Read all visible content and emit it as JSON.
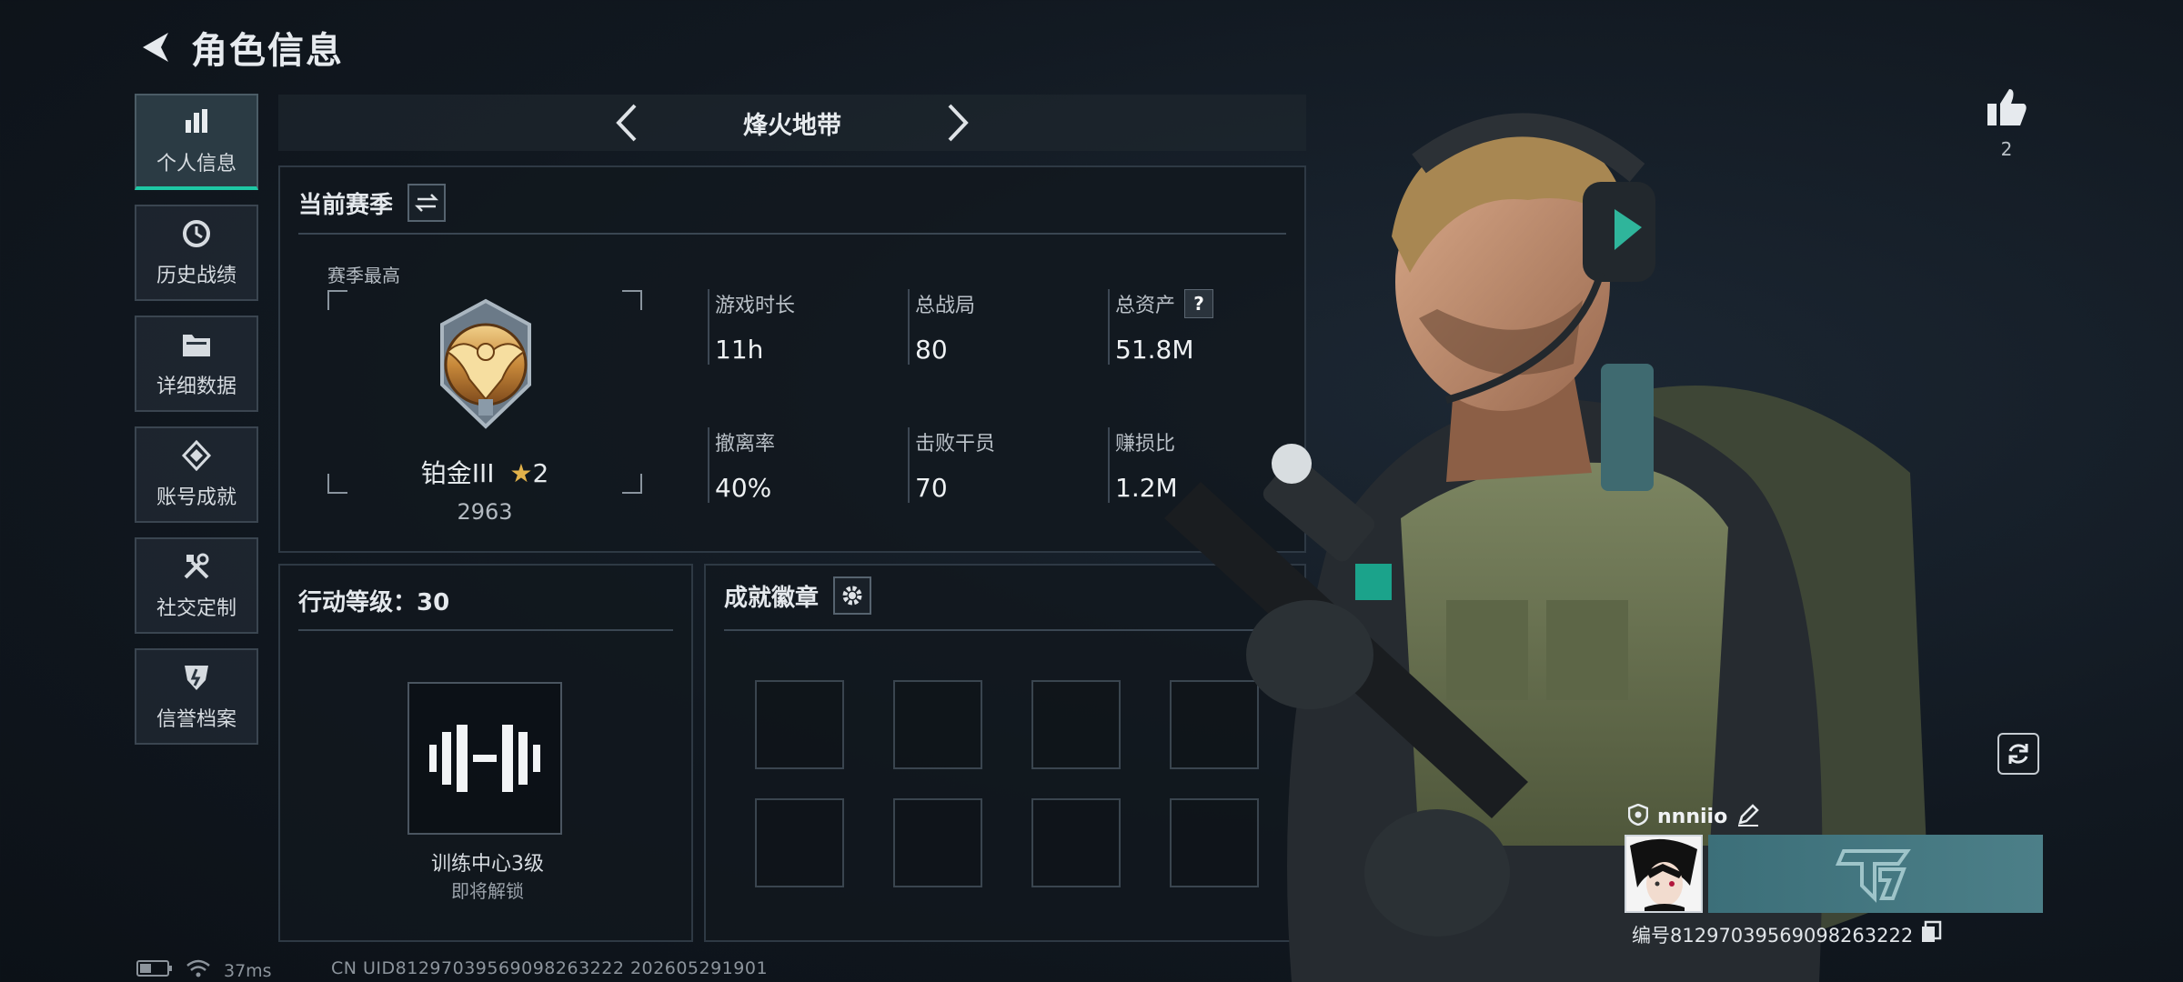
{
  "header": {
    "title": "角色信息"
  },
  "nav": {
    "items": [
      {
        "label": "个人信息",
        "icon": "bar-chart-icon",
        "active": true
      },
      {
        "label": "历史战绩",
        "icon": "history-icon",
        "active": false
      },
      {
        "label": "详细数据",
        "icon": "folder-icon",
        "active": false
      },
      {
        "label": "账号成就",
        "icon": "achievement-icon",
        "active": false
      },
      {
        "label": "社交定制",
        "icon": "tools-icon",
        "active": false
      },
      {
        "label": "信誉档案",
        "icon": "credit-icon",
        "active": false
      }
    ]
  },
  "mode": {
    "title": "烽火地带"
  },
  "season": {
    "title": "当前赛季",
    "peak_label": "赛季最高",
    "rank_name": "铂金III",
    "rank_stars": "2",
    "rank_score": "2963",
    "stats": [
      {
        "key": "游戏时长",
        "value": "11h"
      },
      {
        "key": "总战局",
        "value": "80"
      },
      {
        "key": "总资产",
        "value": "51.8M",
        "help": "?"
      },
      {
        "key": "撤离率",
        "value": "40%"
      },
      {
        "key": "击败干员",
        "value": "70"
      },
      {
        "key": "赚损比",
        "value": "1.2M"
      }
    ]
  },
  "level": {
    "title": "行动等级：30",
    "training_name": "训练中心3级",
    "training_status": "即将解锁"
  },
  "badges": {
    "title": "成就徽章"
  },
  "likes": {
    "count": "2"
  },
  "player": {
    "name": "nnniio",
    "uid_line": "编号81297039569098263222"
  },
  "status_bar": {
    "ping": "37ms",
    "cn_uid": "CN UID81297039569098263222 202605291901"
  },
  "colors": {
    "accent": "#1ec8a5",
    "gold": "#e2b24a"
  }
}
